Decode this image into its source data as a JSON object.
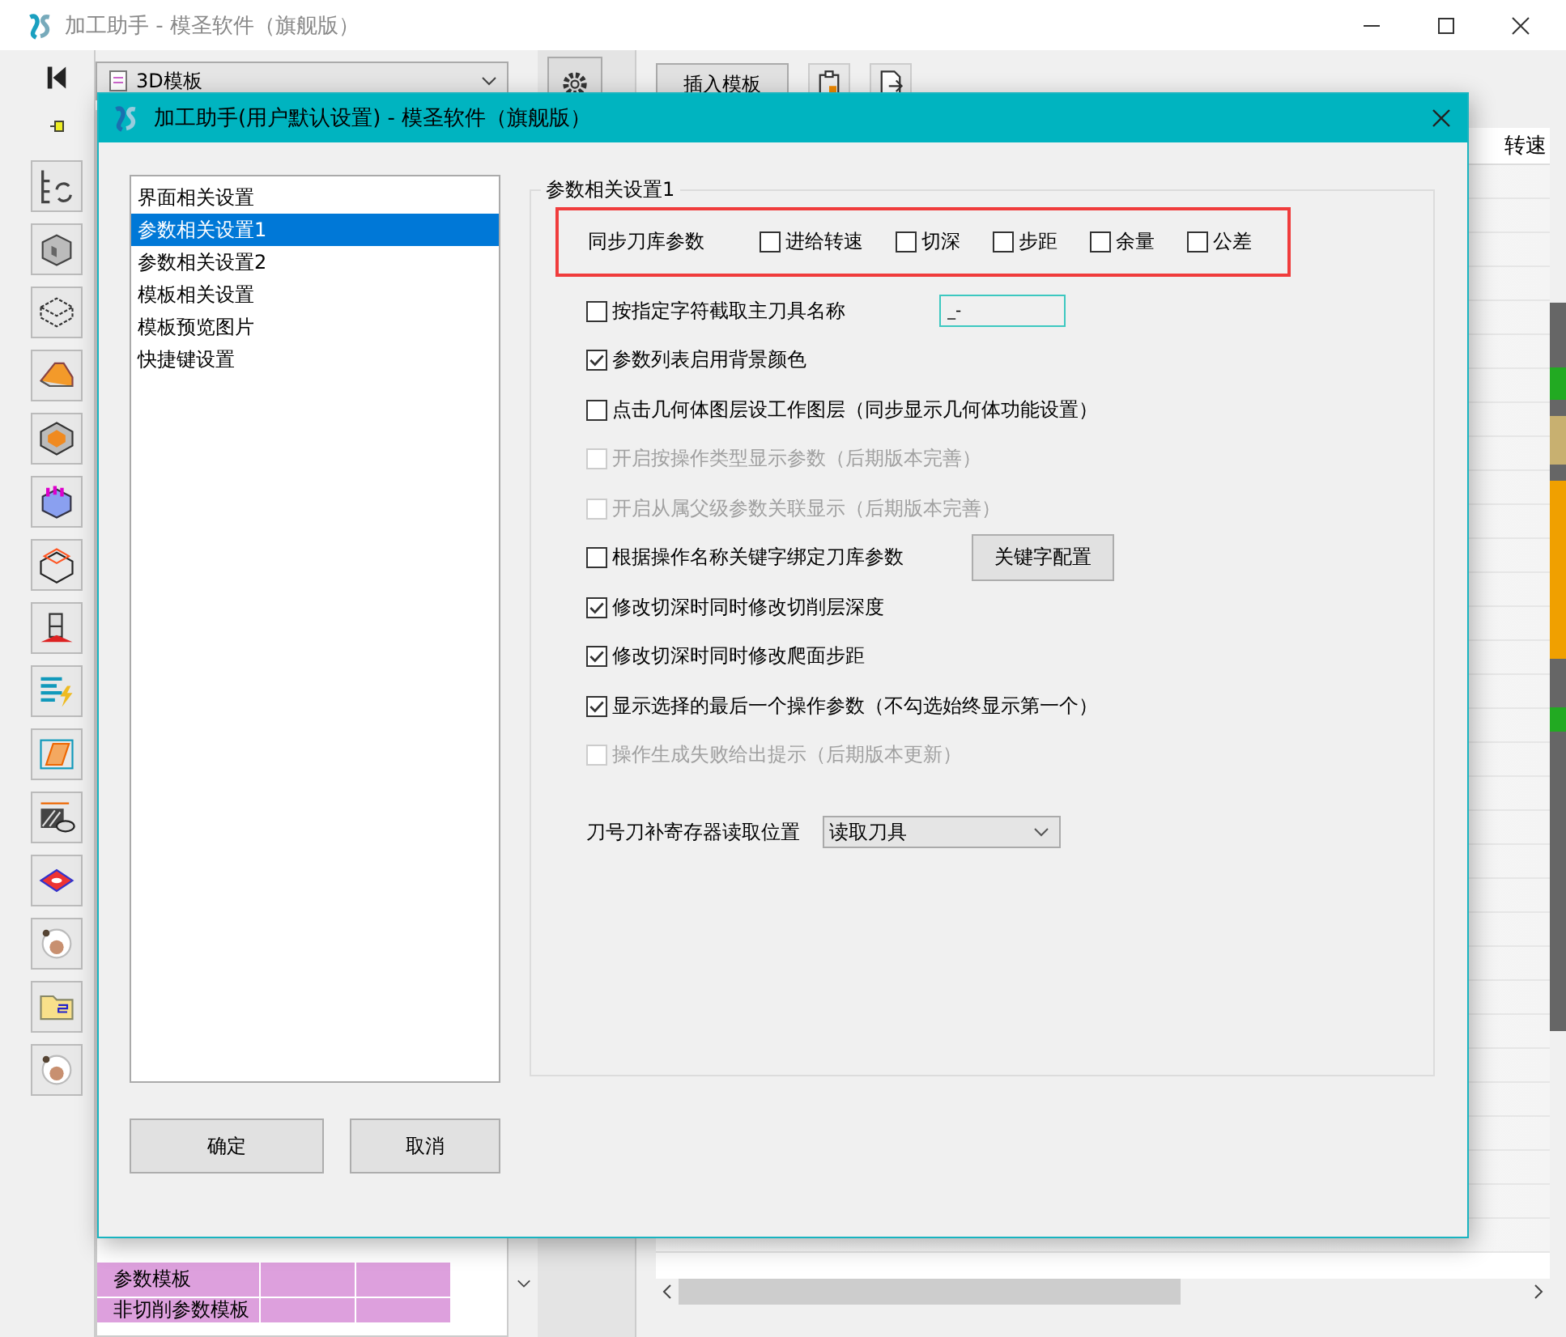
{
  "window": {
    "title": "加工助手 - 模圣软件（旗舰版）"
  },
  "template_dropdown": {
    "value": "3D模板"
  },
  "template_list": {
    "rows": [
      {
        "cells": [
          "参数模板",
          "",
          ""
        ]
      },
      {
        "cells": [
          "非切削参数模板",
          "",
          ""
        ]
      }
    ]
  },
  "toolbar": {
    "insert_button": "插入模板"
  },
  "table": {
    "columns": [
      "转速"
    ]
  },
  "dialog": {
    "title": "加工助手(用户默认设置) - 模圣软件（旗舰版）",
    "nav": [
      {
        "label": "界面相关设置",
        "selected": false
      },
      {
        "label": "参数相关设置1",
        "selected": true
      },
      {
        "label": "参数相关设置2",
        "selected": false
      },
      {
        "label": "模板相关设置",
        "selected": false
      },
      {
        "label": "模板预览图片",
        "selected": false
      },
      {
        "label": "快捷键设置",
        "selected": false
      }
    ],
    "group_title": "参数相关设置1",
    "sync": {
      "label": "同步刀库参数",
      "items": [
        {
          "label": "进给转速",
          "checked": false
        },
        {
          "label": "切深",
          "checked": false
        },
        {
          "label": "步距",
          "checked": false
        },
        {
          "label": "余量",
          "checked": false
        },
        {
          "label": "公差",
          "checked": false
        }
      ]
    },
    "options": [
      {
        "label": "按指定字符截取主刀具名称",
        "checked": false,
        "disabled": false,
        "field": "_-"
      },
      {
        "label": "参数列表启用背景颜色",
        "checked": true,
        "disabled": false
      },
      {
        "label": "点击几何体图层设工作图层（同步显示几何体功能设置）",
        "checked": false,
        "disabled": false
      },
      {
        "label": "开启按操作类型显示参数（后期版本完善）",
        "checked": false,
        "disabled": true
      },
      {
        "label": "开启从属父级参数关联显示（后期版本完善）",
        "checked": false,
        "disabled": true
      },
      {
        "label": "根据操作名称关键字绑定刀库参数",
        "checked": false,
        "disabled": false,
        "button": "关键字配置"
      },
      {
        "label": "修改切深时同时修改切削层深度",
        "checked": true,
        "disabled": false
      },
      {
        "label": "修改切深时同时修改爬面步距",
        "checked": true,
        "disabled": false
      },
      {
        "label": "显示选择的最后一个操作参数（不勾选始终显示第一个）",
        "checked": true,
        "disabled": false
      },
      {
        "label": "操作生成失败给出提示（后期版本更新）",
        "checked": false,
        "disabled": true
      }
    ],
    "register": {
      "label": "刀号刀补寄存器读取位置",
      "value": "读取刀具"
    },
    "buttons": [
      "确定",
      "取消"
    ]
  }
}
